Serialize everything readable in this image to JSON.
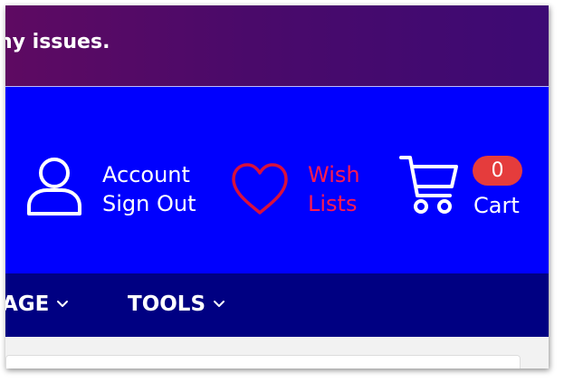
{
  "banner": {
    "text": "ny issues."
  },
  "header": {
    "account": {
      "line1": "Account",
      "line2": "Sign Out",
      "icon": "user-icon"
    },
    "wishlist": {
      "line1": "Wish",
      "line2": "Lists",
      "icon": "heart-icon",
      "color": "#ff1a4f"
    },
    "cart": {
      "count": "0",
      "label": "Cart",
      "icon": "cart-icon",
      "badge_color": "#e53c3c"
    }
  },
  "nav": {
    "items": [
      {
        "label": "AGE",
        "icon": "chevron-down-icon"
      },
      {
        "label": "TOOLS",
        "icon": "chevron-down-icon"
      }
    ]
  },
  "colors": {
    "banner_start": "#5e0a62",
    "banner_end": "#3d0a74",
    "header_bg": "#0000fe",
    "nav_bg": "#000082"
  }
}
